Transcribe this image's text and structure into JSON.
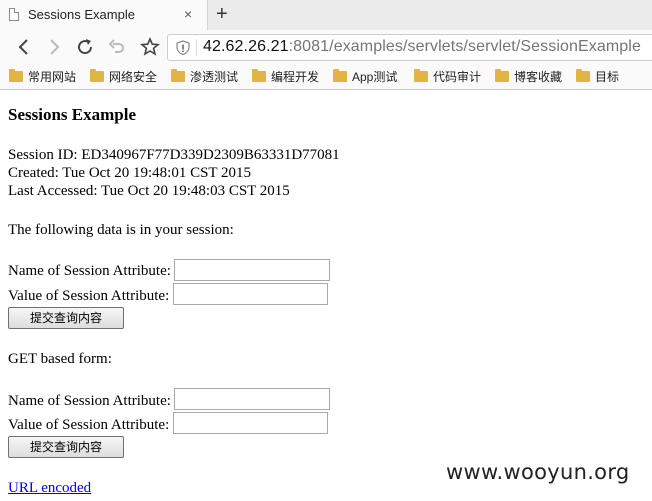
{
  "browser": {
    "tab_title": "Sessions Example",
    "tab_close": "×",
    "new_tab": "+",
    "url_host": "42.62.26.21",
    "url_rest": ":8081/examples/servlets/servlet/SessionExample",
    "bookmarks": [
      "常用网站",
      "网络安全",
      "渗透测试",
      "编程开发",
      "App测试",
      "代码审计",
      "博客收藏",
      "目标"
    ]
  },
  "page": {
    "heading": "Sessions Example",
    "session_id": "Session ID: ED340967F77D339D2309B63331D77081",
    "created": "Created: Tue Oct 20 19:48:01 CST 2015",
    "last_accessed": "Last Accessed: Tue Oct 20 19:48:03 CST 2015",
    "data_intro": "The following data is in your session:",
    "post_form": {
      "name_label": "Name of Session Attribute:",
      "value_label": "Value of Session Attribute:",
      "name_value": "",
      "value_value": "",
      "submit_label": "提交查询内容"
    },
    "get_heading": "GET based form:",
    "get_form": {
      "name_label": "Name of Session Attribute:",
      "value_label": "Value of Session Attribute:",
      "name_value": "",
      "value_value": "",
      "submit_label": "提交查询内容"
    },
    "url_encoded_link": "URL encoded"
  },
  "watermark": "www.wooyun.org"
}
